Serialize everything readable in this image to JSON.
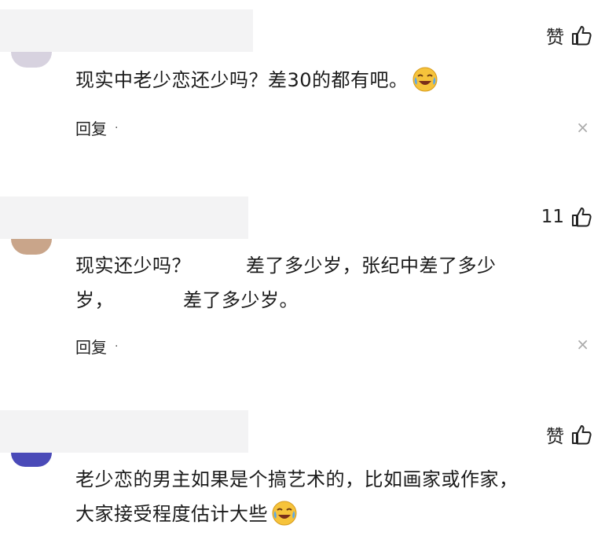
{
  "comments": [
    {
      "likes": "赞",
      "text": "现实中老少恋还少吗？差30的都有吧。",
      "emoji": "crying-laughing-emoji",
      "reply": "回复",
      "dot": "·",
      "close": "×",
      "avatar_color": "#d7d2df"
    },
    {
      "likes": "11",
      "text_a": "现实还少吗？",
      "text_b": "差了多少岁，张纪中差了多少",
      "text_c": "岁，",
      "text_d": "差了多少岁。",
      "reply": "回复",
      "dot": "·",
      "close": "×",
      "avatar_color": "#c9a58a"
    },
    {
      "likes": "赞",
      "text_a": "老少恋的男主如果是个搞艺术的，比如画家或作家，",
      "text_b": "大家接受程度估计大些",
      "emoji": "crying-laughing-emoji",
      "avatar_color": "#4a4ab8"
    }
  ]
}
